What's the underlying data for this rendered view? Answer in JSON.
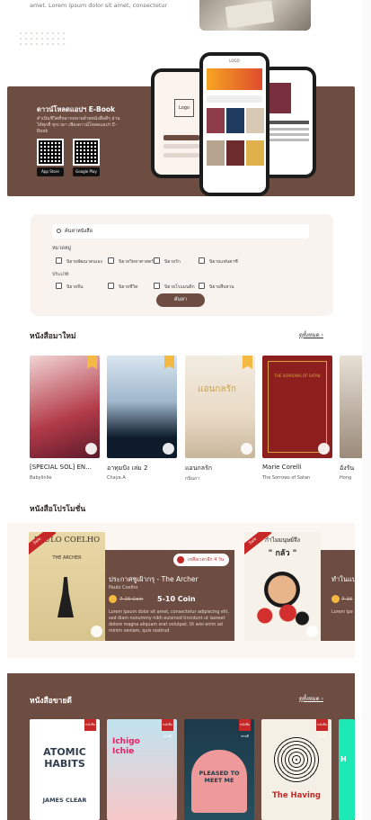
{
  "top": {
    "text": "amet. Lorem ipsum dolor sit amet, consectetur"
  },
  "app": {
    "title": "ดาวน์โหลดแอปฯ E-Book",
    "desc": "ดำเนินชีวิตที่หลากหลายด้วยหนังสือดีๆ อ่านได้ทุกที่ ทุกเวลา เพียงดาวน์โหลดแอปฯ E-Book",
    "store1": "App Store",
    "store2": "Google Play",
    "logo": "Logo",
    "phone_brand": "LOGO"
  },
  "search": {
    "placeholder": "ค้นหาหนังสือ",
    "cat_label": "หมวดหมู่",
    "cats": [
      "นิยายพัฒนาตนเอง",
      "นิยายวิทยาศาสตร์",
      "นิยายรัก",
      "นิยายแฟนตาซี"
    ],
    "type_label": "ประเภท",
    "types": [
      "นิยายจีน",
      "นิยายชีวิต",
      "นิยายโรแมนติก",
      "นิยายสืบสวน"
    ],
    "button": "ค้นหา"
  },
  "new_books": {
    "title": "หนังสือมาใหม่",
    "see_all": "ดูทั้งหมด",
    "items": [
      {
        "title": "[SPECIAL SOL] EN...",
        "author": "Babylinlie"
      },
      {
        "title": "อาทุมปัง เล่ม 2",
        "author": "Chaya.A"
      },
      {
        "title": "แอนกลรัก",
        "author": "กนิ่นภา"
      },
      {
        "title": "Marie Corelli",
        "author": "The Sorrows of Satan"
      },
      {
        "title": "อังรัน",
        "author": "Hong"
      }
    ]
  },
  "promo": {
    "title": "หนังสือโปรโมชั่น",
    "items": [
      {
        "title": "ประกาศชูเฝ้ากรุ - The Archer",
        "author": "Paulo Coelho",
        "price_old": "7-15 Coin",
        "price": "5-10 Coin",
        "timer": "เหลือเวลาอีก 4 วัน",
        "sale": "Sale",
        "desc": "Lorem ipsum dolor sit amet, consectetur adipiscing elit, sed diam nonummy nibh euismod tincidunt ut laoreet dolore magna aliquam erat volutpat. Ut wisi enim ad minim veniam, quis nostrud"
      },
      {
        "title": "ทำในแบบ",
        "author": "",
        "price_old": "7-15",
        "price": "",
        "timer": "",
        "sale": "Sale",
        "desc": "Lorem ipsum dolor sit amet, sed diam nonummy dolore magna quis nostrud exerci"
      }
    ]
  },
  "best": {
    "title": "หนังสือขายดี",
    "see_all": "ดูทั้งหมด",
    "tag": "หนังสือขายดี",
    "covers": [
      "ATOMIC HABITS",
      "Ichigo Ichie",
      "PLEASED TO MEET ME",
      "The Having",
      "H"
    ]
  },
  "covers": {
    "coelho": "PAULO COELHO",
    "archer": "THE ARCHER",
    "clear": "JAMES CLEAR",
    "fear_top": "กำไมมนุษย์จึง",
    "fear_mid": "\" กลัว \"",
    "marie": "THE SORROWS OF SATAN",
    "story": "แอนกลรัก"
  },
  "colors": {
    "brand": "#6d4c41",
    "accent": "#c62828",
    "gold": "#f4b942"
  }
}
